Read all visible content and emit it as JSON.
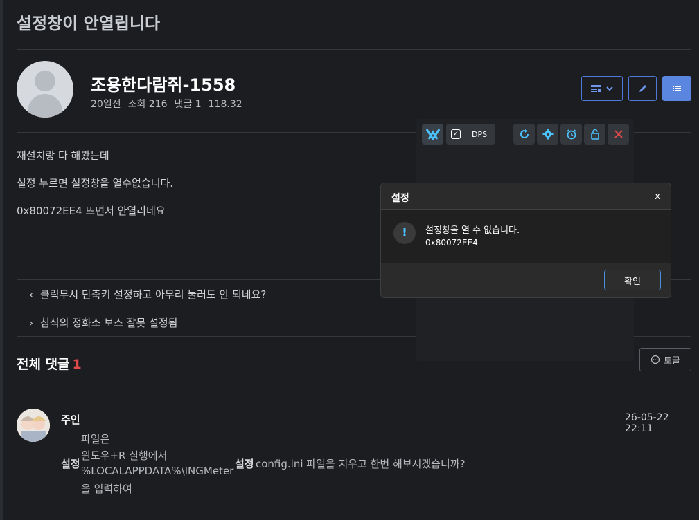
{
  "post": {
    "title": "설정창이 안열립니다",
    "author": "조용한다람쥐-1558",
    "meta": {
      "time": "20일전",
      "views": "조회 216",
      "comments": "댓글 1",
      "version": "118.32"
    },
    "content": [
      "재설치랑 다 해봤는데",
      "설정 누르면 설정창을 열수없습니다.",
      "0x80072EE4 뜨면서 안열리네요"
    ]
  },
  "navigation": {
    "prev": "클릭무시 단축키 설정하고 아무리 눌러도 안 되네요?",
    "next": "침식의 정화소 보스 잘못 설정됨"
  },
  "comments": {
    "title": "전체 댓글",
    "count": "1",
    "toggle_label": "토글",
    "items": [
      {
        "author": "주인",
        "date": "26-05-22 22:11",
        "bold1": "설정",
        "lines": [
          "파일은",
          "윈도우+R 실행에서",
          "%LOCALAPPDATA%\\INGMeter",
          "을 입력하여"
        ],
        "bold2": "설정",
        "tail": "config.ini 파일을 지우고 한번 해보시겠습니까?"
      }
    ]
  },
  "overlay": {
    "dps_label": "DPS"
  },
  "dialog": {
    "title": "설정",
    "close": "x",
    "message": "설정창을 열 수 없습니다.",
    "code": "0x80072EE4",
    "ok_label": "확인"
  },
  "colors": {
    "accent": "#5a86e0",
    "count_red": "#e14a4a",
    "overlay_icon": "#4cc2ff",
    "close_red": "#e04a4a"
  }
}
